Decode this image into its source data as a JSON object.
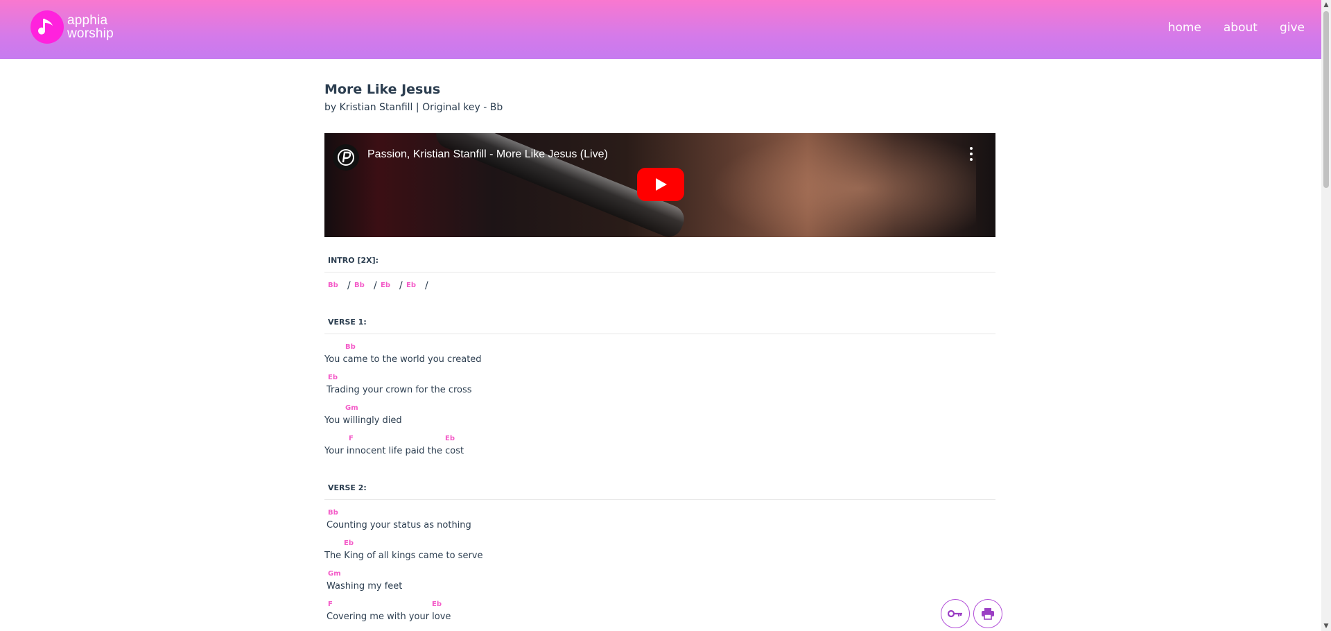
{
  "brand": {
    "line1": "apphia",
    "line2": "worship",
    "accent": "#ff22dd"
  },
  "nav": {
    "home": "home",
    "about": "about",
    "give": "give"
  },
  "song": {
    "title": "More Like Jesus",
    "subtitle": "by Kristian Stanfill | Original key - Bb"
  },
  "video": {
    "title": "Passion, Kristian Stanfill - More Like Jesus (Live)"
  },
  "intro": {
    "label": "INTRO [2X]:",
    "chords": [
      "Bb",
      "Bb",
      "Eb",
      "Eb"
    ],
    "separator": "/"
  },
  "verse1": {
    "label": "VERSE 1:",
    "lines": [
      {
        "chords": [
          "Bb"
        ],
        "lyric": "You came to the world you created"
      },
      {
        "chords": [
          "Eb"
        ],
        "lyric": "Trading your crown for the cross"
      },
      {
        "chords": [
          "Gm"
        ],
        "lyric": "You willingly died"
      },
      {
        "chords": [
          "F",
          "Eb"
        ],
        "lyric": "Your innocent life paid the cost"
      }
    ]
  },
  "verse2": {
    "label": "VERSE 2:",
    "lines": [
      {
        "chords": [
          "Bb"
        ],
        "lyric": "Counting your status as nothing"
      },
      {
        "chords": [
          "Eb"
        ],
        "lyric": "The King of all kings came to serve"
      },
      {
        "chords": [
          "Gm"
        ],
        "lyric": "Washing my feet"
      },
      {
        "chords": [
          "F",
          "Eb"
        ],
        "lyric": "Covering me with your love"
      }
    ]
  },
  "actions": {
    "key_icon": "key-icon",
    "print_icon": "print-icon"
  },
  "colors": {
    "chord": "#f45bc8",
    "text": "#2c3e50",
    "header_top": "#f978cf",
    "header_bottom": "#c67bf0"
  }
}
